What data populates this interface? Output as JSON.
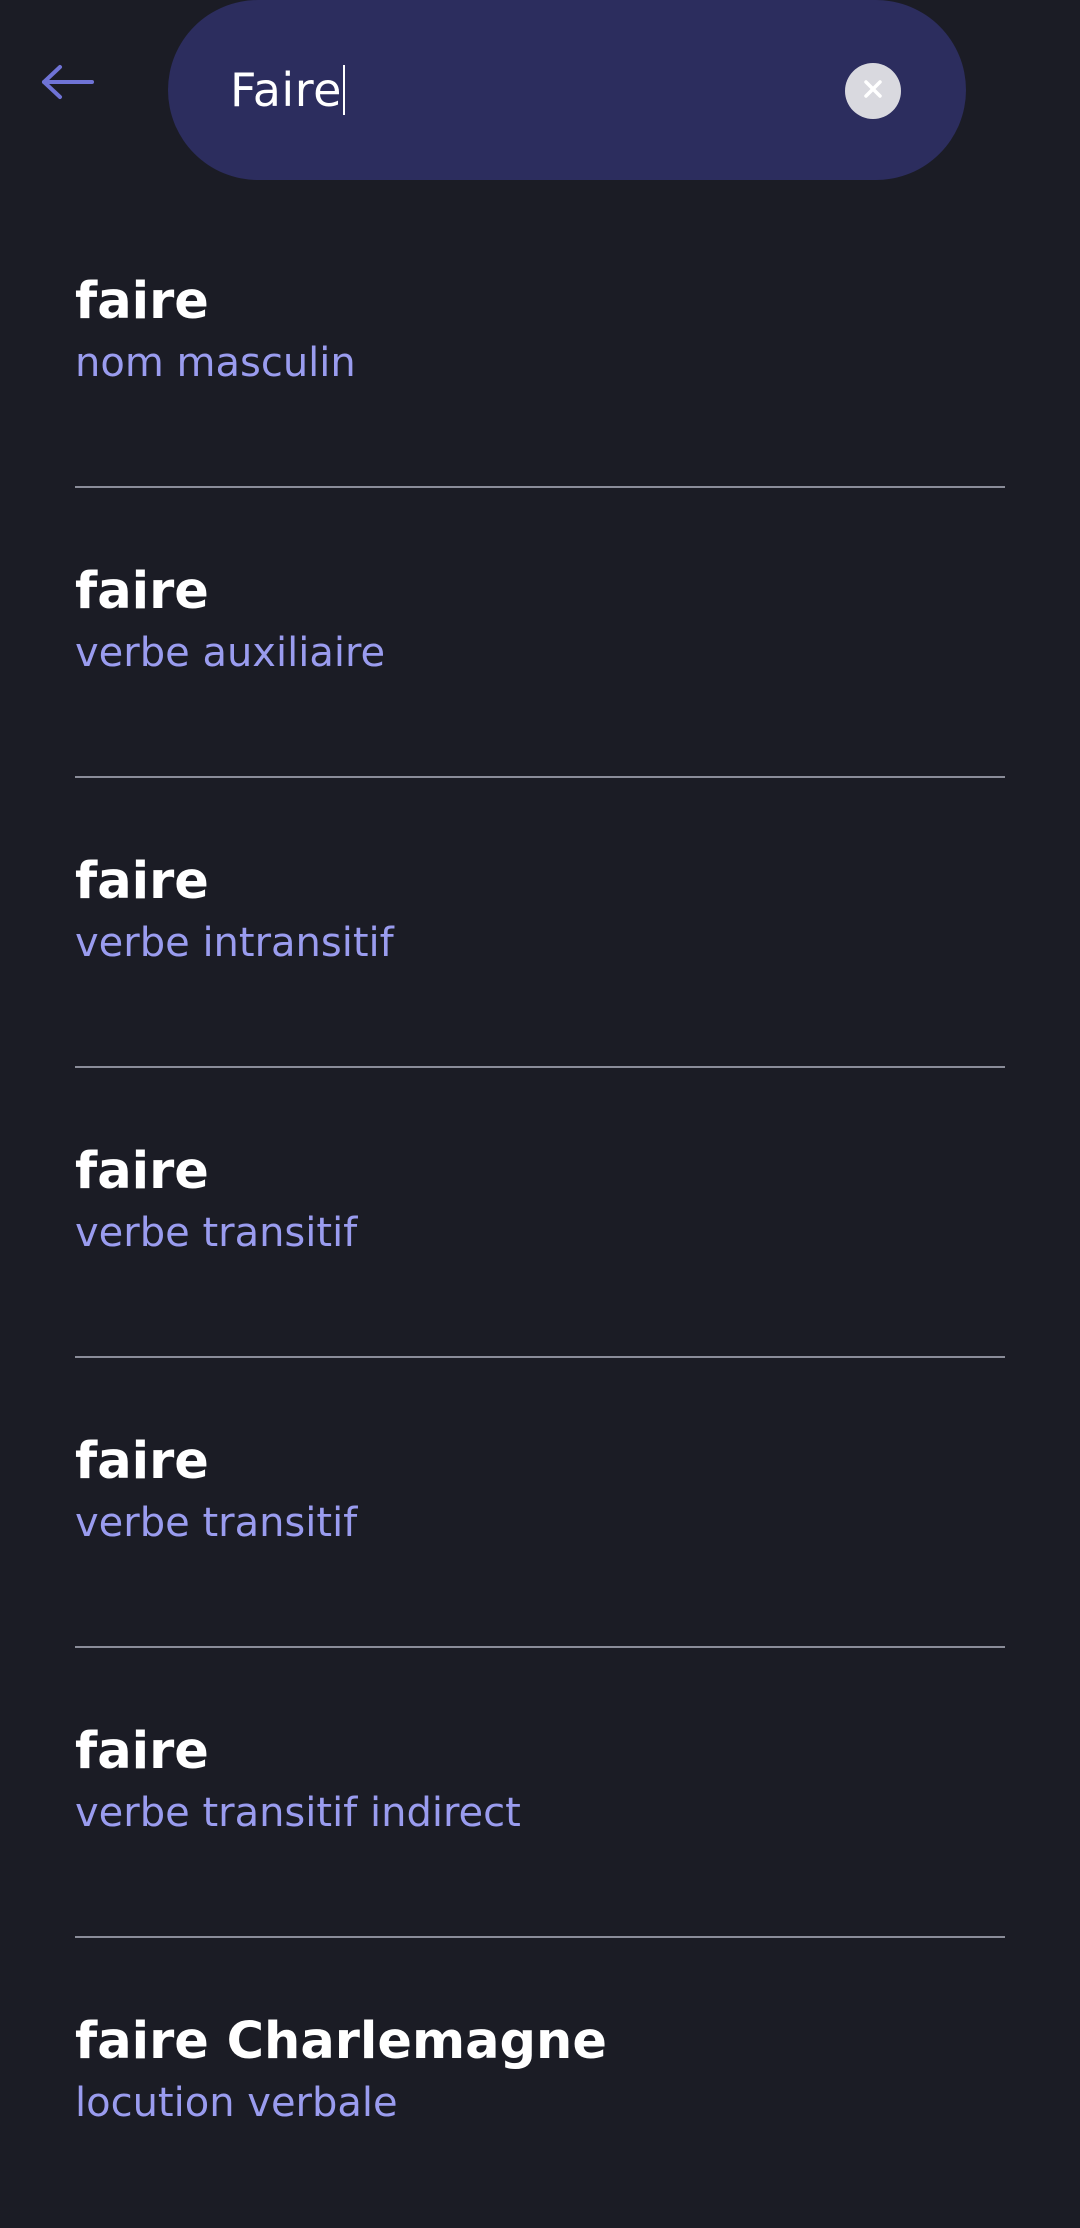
{
  "header": {
    "back_icon": "arrow-left-icon",
    "clear_icon": "close-circle-icon"
  },
  "search": {
    "value": "Faire"
  },
  "colors": {
    "background": "#1b1c25",
    "search_bar": "#2c2d5e",
    "accent": "#9a9cef",
    "word": "#ffffff",
    "back_arrow": "#6f73d6"
  },
  "results": [
    {
      "word": "faire",
      "category": "nom masculin"
    },
    {
      "word": "faire",
      "category": "verbe auxiliaire"
    },
    {
      "word": "faire",
      "category": "verbe intransitif"
    },
    {
      "word": "faire",
      "category": "verbe transitif"
    },
    {
      "word": "faire",
      "category": "verbe transitif"
    },
    {
      "word": "faire",
      "category": "verbe transitif indirect"
    },
    {
      "word": "faire Charlemagne",
      "category": "locution verbale"
    }
  ]
}
